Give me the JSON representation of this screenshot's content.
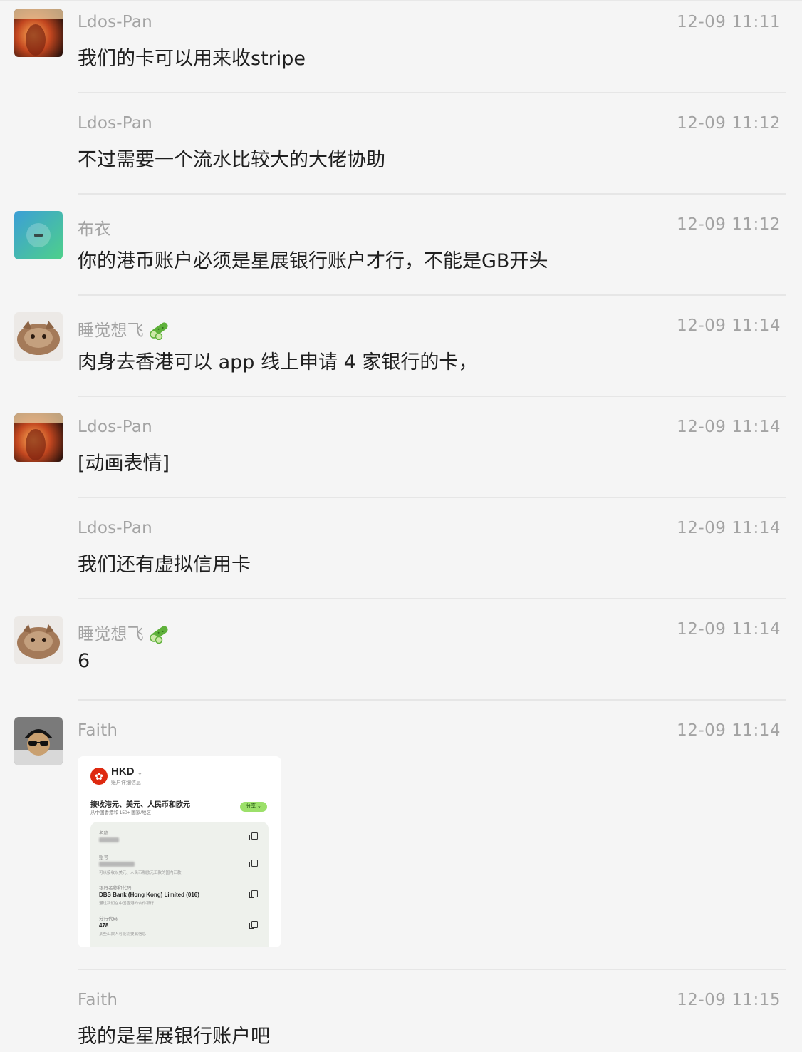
{
  "messages": [
    {
      "sender": "Ldos-Pan",
      "time": "12-09 11:11",
      "text": "我们的卡可以用来收stripe"
    },
    {
      "sender": "Ldos-Pan",
      "time": "12-09 11:12",
      "text": "不过需要一个流水比较大的大佬协助"
    },
    {
      "sender": "布衣",
      "time": "12-09 11:12",
      "text": "你的港币账户必须是星展银行账户才行，不能是GB开头"
    },
    {
      "sender": "睡觉想飞",
      "time": "12-09 11:14",
      "text": "肉身去香港可以 app 线上申请 4 家银行的卡，"
    },
    {
      "sender": "Ldos-Pan",
      "time": "12-09 11:14",
      "text": "[动画表情]"
    },
    {
      "sender": "Ldos-Pan",
      "time": "12-09 11:14",
      "text": "我们还有虚拟信用卡"
    },
    {
      "sender": "睡觉想飞",
      "time": "12-09 11:14",
      "text": "6"
    },
    {
      "sender": "Faith",
      "time": "12-09 11:14",
      "text": ""
    },
    {
      "sender": "Faith",
      "time": "12-09 11:15",
      "text": "我的是星展银行账户吧"
    }
  ],
  "image_card": {
    "currency": "HKD",
    "currency_sub": "账户详细信息",
    "heading": "接收港元、美元、人民币和欧元",
    "heading_sub": "从中国香港和 150+ 国家/地区",
    "share_label": "分享 ⌄",
    "field1_label": "名称",
    "field2_label": "账号",
    "field2_note": "可以接收以美元、人民币和欧元汇款的国内汇款",
    "field3_label": "银行名称和代码",
    "field3_value": "DBS Bank (Hong Kong) Limited (016)",
    "field3_note": "通过我们在中国香港的合作银行",
    "field4_label": "分行代码",
    "field4_value": "478",
    "field4_note": "某些汇款人可能需要此信息"
  },
  "colors": {
    "background": "#f5f5f5",
    "meta_text": "#a3a3a3",
    "body_text": "#1f1f1f",
    "share_green": "#9ce06a"
  }
}
